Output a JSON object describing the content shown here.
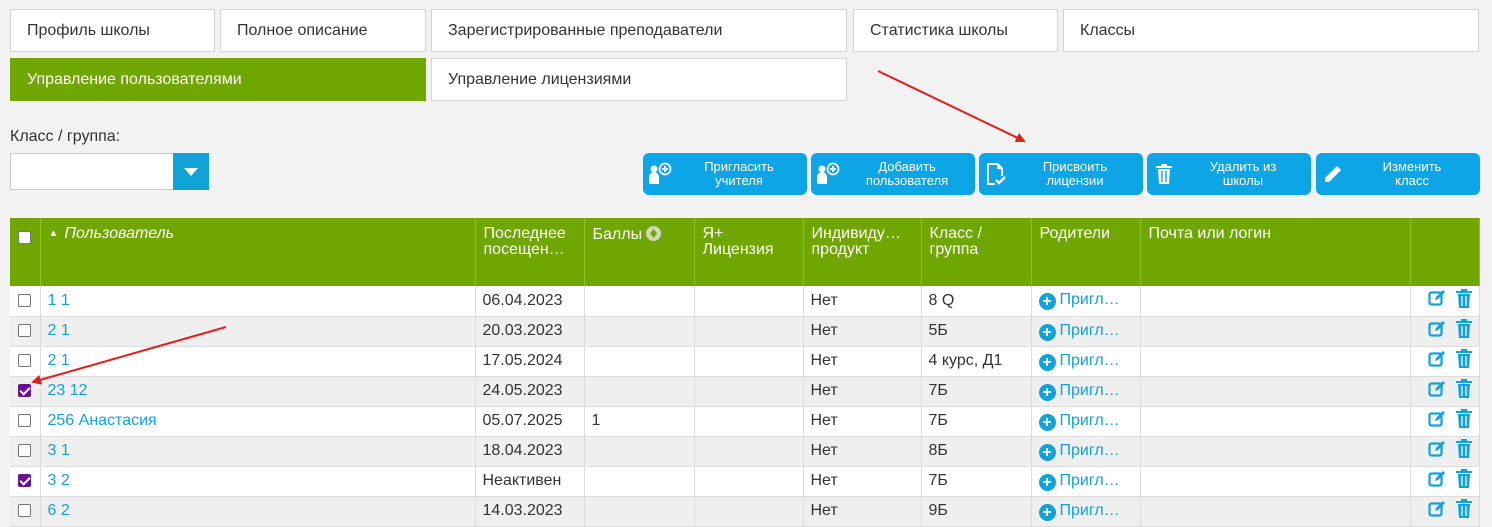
{
  "tabs": [
    {
      "label": "Профиль школы",
      "active": false
    },
    {
      "label": "Полное описание",
      "active": false
    },
    {
      "label": "Зарегистрированные преподаватели",
      "active": false
    },
    {
      "label": "Статистика школы",
      "active": false
    },
    {
      "label": "Классы",
      "active": false
    },
    {
      "label": "Управление пользователями",
      "active": true
    },
    {
      "label": "Управление лицензиями",
      "active": false
    }
  ],
  "filter": {
    "label": "Класс / группа:",
    "value": ""
  },
  "actions": [
    {
      "label": "Пригласить\nучителя",
      "icon": "invite-teacher-icon"
    },
    {
      "label": "Добавить\nпользователя",
      "icon": "add-user-icon"
    },
    {
      "label": "Присвоить\nлицензии",
      "icon": "assign-license-icon"
    },
    {
      "label": "Удалить из\nшколы",
      "icon": "trash-icon"
    },
    {
      "label": "Изменить\nкласс",
      "icon": "pencil-icon"
    }
  ],
  "table": {
    "columns": [
      "Пользователь",
      "Последнее посещен…",
      "Баллы",
      "Я+ Лицензия",
      "Индивиду… продукт",
      "Класс / группа",
      "Родители",
      "Почта или логин"
    ],
    "invite_label": "Пригл…",
    "rows": [
      {
        "checked": false,
        "user": "1 1",
        "last": "06.04.2023",
        "points": "",
        "license": "",
        "individual": "Нет",
        "class": "8 Q",
        "email": ""
      },
      {
        "checked": false,
        "user": "2 1",
        "last": "20.03.2023",
        "points": "",
        "license": "",
        "individual": "Нет",
        "class": "5Б",
        "email": ""
      },
      {
        "checked": false,
        "user": "2 1",
        "last": "17.05.2024",
        "points": "",
        "license": "",
        "individual": "Нет",
        "class": "4 курс, Д1",
        "email": ""
      },
      {
        "checked": true,
        "user": "23 12",
        "last": "24.05.2023",
        "points": "",
        "license": "",
        "individual": "Нет",
        "class": "7Б",
        "email": ""
      },
      {
        "checked": false,
        "user": "256 Анастасия",
        "last": "05.07.2025",
        "points": "1",
        "license": "",
        "individual": "Нет",
        "class": "7Б",
        "email": ""
      },
      {
        "checked": false,
        "user": "3 1",
        "last": "18.04.2023",
        "points": "",
        "license": "",
        "individual": "Нет",
        "class": "8Б",
        "email": ""
      },
      {
        "checked": true,
        "user": "3 2",
        "last": "Неактивен",
        "points": "",
        "license": "",
        "individual": "Нет",
        "class": "7Б",
        "email": ""
      },
      {
        "checked": false,
        "user": "6 2",
        "last": "14.03.2023",
        "points": "",
        "license": "",
        "individual": "Нет",
        "class": "9Б",
        "email": ""
      }
    ]
  },
  "colors": {
    "green": "#6fa600",
    "blue": "#0ea5e6",
    "link": "#11a3d8",
    "arrow": "#e02020",
    "checked": "#6a0f95"
  }
}
